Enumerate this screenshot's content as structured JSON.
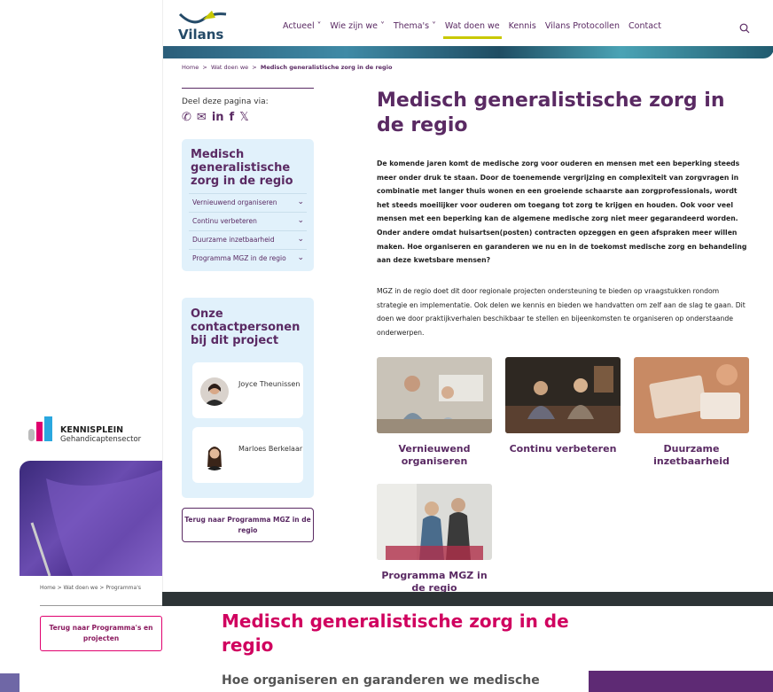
{
  "main": {
    "logo_text": "Vilans",
    "nav": [
      "Actueel",
      "Wie zijn we",
      "Thema's",
      "Wat doen we",
      "Kennis",
      "Vilans Protocollen",
      "Contact"
    ],
    "breadcrumb": {
      "home": "Home",
      "sep1": ">",
      "parent": "Wat doen we",
      "sep2": ">",
      "current": "Medisch generalistische zorg in de regio"
    },
    "share_label": "Deel deze pagina via:",
    "sidebar": {
      "heading": "Medisch generalistische zorg in de regio",
      "items": [
        "Vernieuwend organiseren",
        "Continu verbeteren",
        "Duurzame inzetbaarheid",
        "Programma MGZ in de regio"
      ]
    },
    "contacts": {
      "heading": "Onze contactpersonen bij dit project",
      "people": [
        {
          "name": "Joyce Theunissen"
        },
        {
          "name": "Marloes Berkelaar"
        }
      ]
    },
    "back_button": "Terug naar Programma MGZ in de regio",
    "title": "Medisch generalistische zorg in de regio",
    "intro": "De komende jaren komt de medische zorg voor ouderen en mensen met een beperking steeds meer onder druk te staan. Door de toenemende vergrijzing en complexiteit van zorgvragen in combinatie met langer thuis wonen en een groeiende schaarste aan zorgprofessionals, wordt het steeds moeilijker voor ouderen om toegang tot zorg te krijgen en houden. Ook voor veel mensen met een beperking kan de algemene medische zorg niet meer gegarandeerd worden. Onder andere omdat huisartsen(posten) contracten opzeggen en geen afspraken meer willen maken. Hoe organiseren en garanderen we nu en in de toekomst medische zorg en behandeling aan deze kwetsbare mensen?",
    "body": "MGZ in de regio doet dit door regionale projecten ondersteuning te bieden op vraagstukken rondom strategie en implementatie. Ook delen we kennis en bieden we handvatten om zelf aan de slag te gaan. Dit doen we door praktijkverhalen beschikbaar te stellen en bijeenkomsten te organiseren op onderstaande onderwerpen.",
    "tiles": [
      "Vernieuwend organiseren",
      "Continu verbeteren",
      "Duurzame inzetbaarheid",
      "Programma MGZ in de regio"
    ]
  },
  "second": {
    "logo_title": "KENNISPLEIN",
    "logo_sub": "Gehandicaptensector",
    "breadcrumb": "Home  >  Wat doen we  >  Programma's",
    "back_button": "Terug naar Programma's en projecten",
    "title": "Medisch generalistische zorg in de regio",
    "subtitle": "Hoe organiseren en garanderen we medische"
  },
  "colors": {
    "brand_purple": "#5a2a63",
    "accent_yellow": "#c8c800",
    "pink": "#d0005f",
    "panel_blue": "#e1f1fb"
  },
  "icons": [
    "whatsapp-icon",
    "mail-icon",
    "linkedin-icon",
    "facebook-icon",
    "x-icon",
    "search-icon",
    "chevron-down-icon"
  ]
}
